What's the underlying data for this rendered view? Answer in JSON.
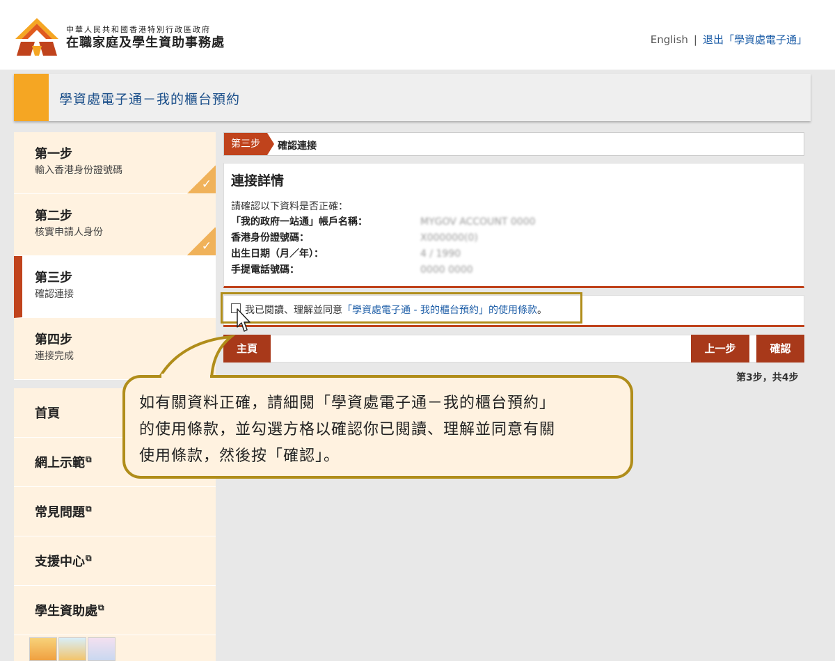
{
  "header": {
    "org_line1": "中華人民共和國香港特別行政區政府",
    "org_line2": "在職家庭及學生資助事務處",
    "lang_link": "English",
    "separator": "|",
    "logout_link": "退出「學資處電子通」"
  },
  "titlebar": {
    "title": "學資處電子通－我的櫃台預約"
  },
  "steps": [
    {
      "title": "第一步",
      "desc": "輸入香港身份證號碼",
      "done": true
    },
    {
      "title": "第二步",
      "desc": "核實申請人身份",
      "done": true
    },
    {
      "title": "第三步",
      "desc": "確認連接",
      "active": true
    },
    {
      "title": "第四步",
      "desc": "連接完成"
    }
  ],
  "menu": [
    {
      "label": "首頁"
    },
    {
      "label": "網上示範",
      "icon": "external-link-icon"
    },
    {
      "label": "常見問題",
      "icon": "external-link-icon"
    },
    {
      "label": "支援中心",
      "icon": "external-link-icon"
    },
    {
      "label": "學生資助處",
      "icon": "external-link-icon"
    }
  ],
  "main": {
    "step_tag": "第三步",
    "step_label": "確認連接",
    "details_title": "連接詳情",
    "intro": "請確認以下資料是否正確：",
    "fields": [
      {
        "label": "「我的政府一站通」帳戶名稱：",
        "value": "MYGOV ACCOUNT 0000"
      },
      {
        "label": "香港身份證號碼：",
        "value": "X000000(0)"
      },
      {
        "label": "出生日期（月／年）：",
        "value": "4 / 1990"
      },
      {
        "label": "手提電話號碼：",
        "value": "0000 0000"
      }
    ],
    "agree_prefix": "我已閱讀、理解並同意",
    "agree_link": "「學資處電子通 - 我的櫃台預約」的使用條款",
    "agree_suffix": "。",
    "home_button": "主頁",
    "prev_button": "上一步",
    "confirm_button": "確認",
    "counter": "第3步，共4步"
  },
  "callout": {
    "line1": "如有關資料正確，請細閱「學資處電子通－我的櫃台預約」",
    "line2": "的使用條款，並勾選方格以確認你已閱讀、理解並同意有關",
    "line3": "使用條款，然後按「確認」。"
  },
  "colors": {
    "accent": "#f5a623",
    "brand_red": "#c0431c",
    "button": "#a8391a",
    "link": "#1f5fa8",
    "highlight": "#b08d1a"
  }
}
